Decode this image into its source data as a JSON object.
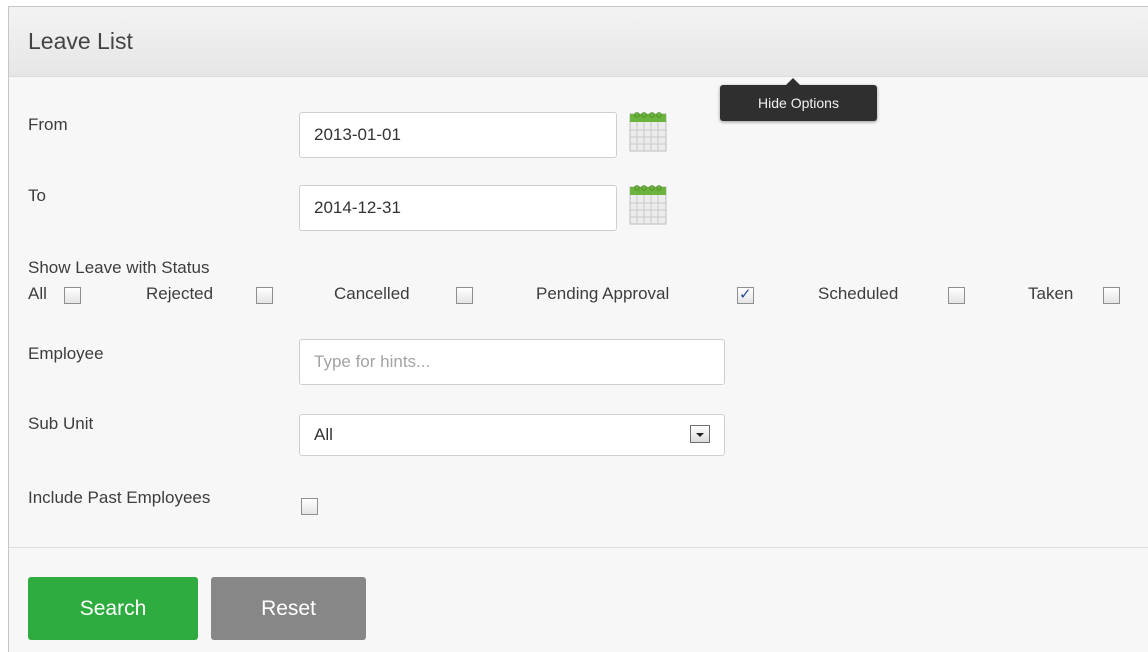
{
  "header": {
    "title": "Leave List"
  },
  "tooltip": {
    "text": "Hide Options"
  },
  "form": {
    "from": {
      "label": "From",
      "value": "2013-01-01"
    },
    "to": {
      "label": "To",
      "value": "2014-12-31"
    },
    "status": {
      "label": "Show Leave with Status",
      "options": [
        {
          "label": "All",
          "checked": false
        },
        {
          "label": "Rejected",
          "checked": false
        },
        {
          "label": "Cancelled",
          "checked": false
        },
        {
          "label": "Pending Approval",
          "checked": true
        },
        {
          "label": "Scheduled",
          "checked": false
        },
        {
          "label": "Taken",
          "checked": false
        }
      ]
    },
    "employee": {
      "label": "Employee",
      "placeholder": "Type for hints...",
      "value": ""
    },
    "sub_unit": {
      "label": "Sub Unit",
      "value": "All"
    },
    "past_employees": {
      "label": "Include Past Employees",
      "checked": false
    }
  },
  "actions": {
    "search_label": "Search",
    "reset_label": "Reset"
  },
  "colors": {
    "search_button": "#2fac3f",
    "reset_button": "#878787",
    "calendar_icon": "#6bb33c"
  },
  "icons": {
    "calendar": "calendar-icon",
    "select_arrow": "chevron-down-icon"
  }
}
